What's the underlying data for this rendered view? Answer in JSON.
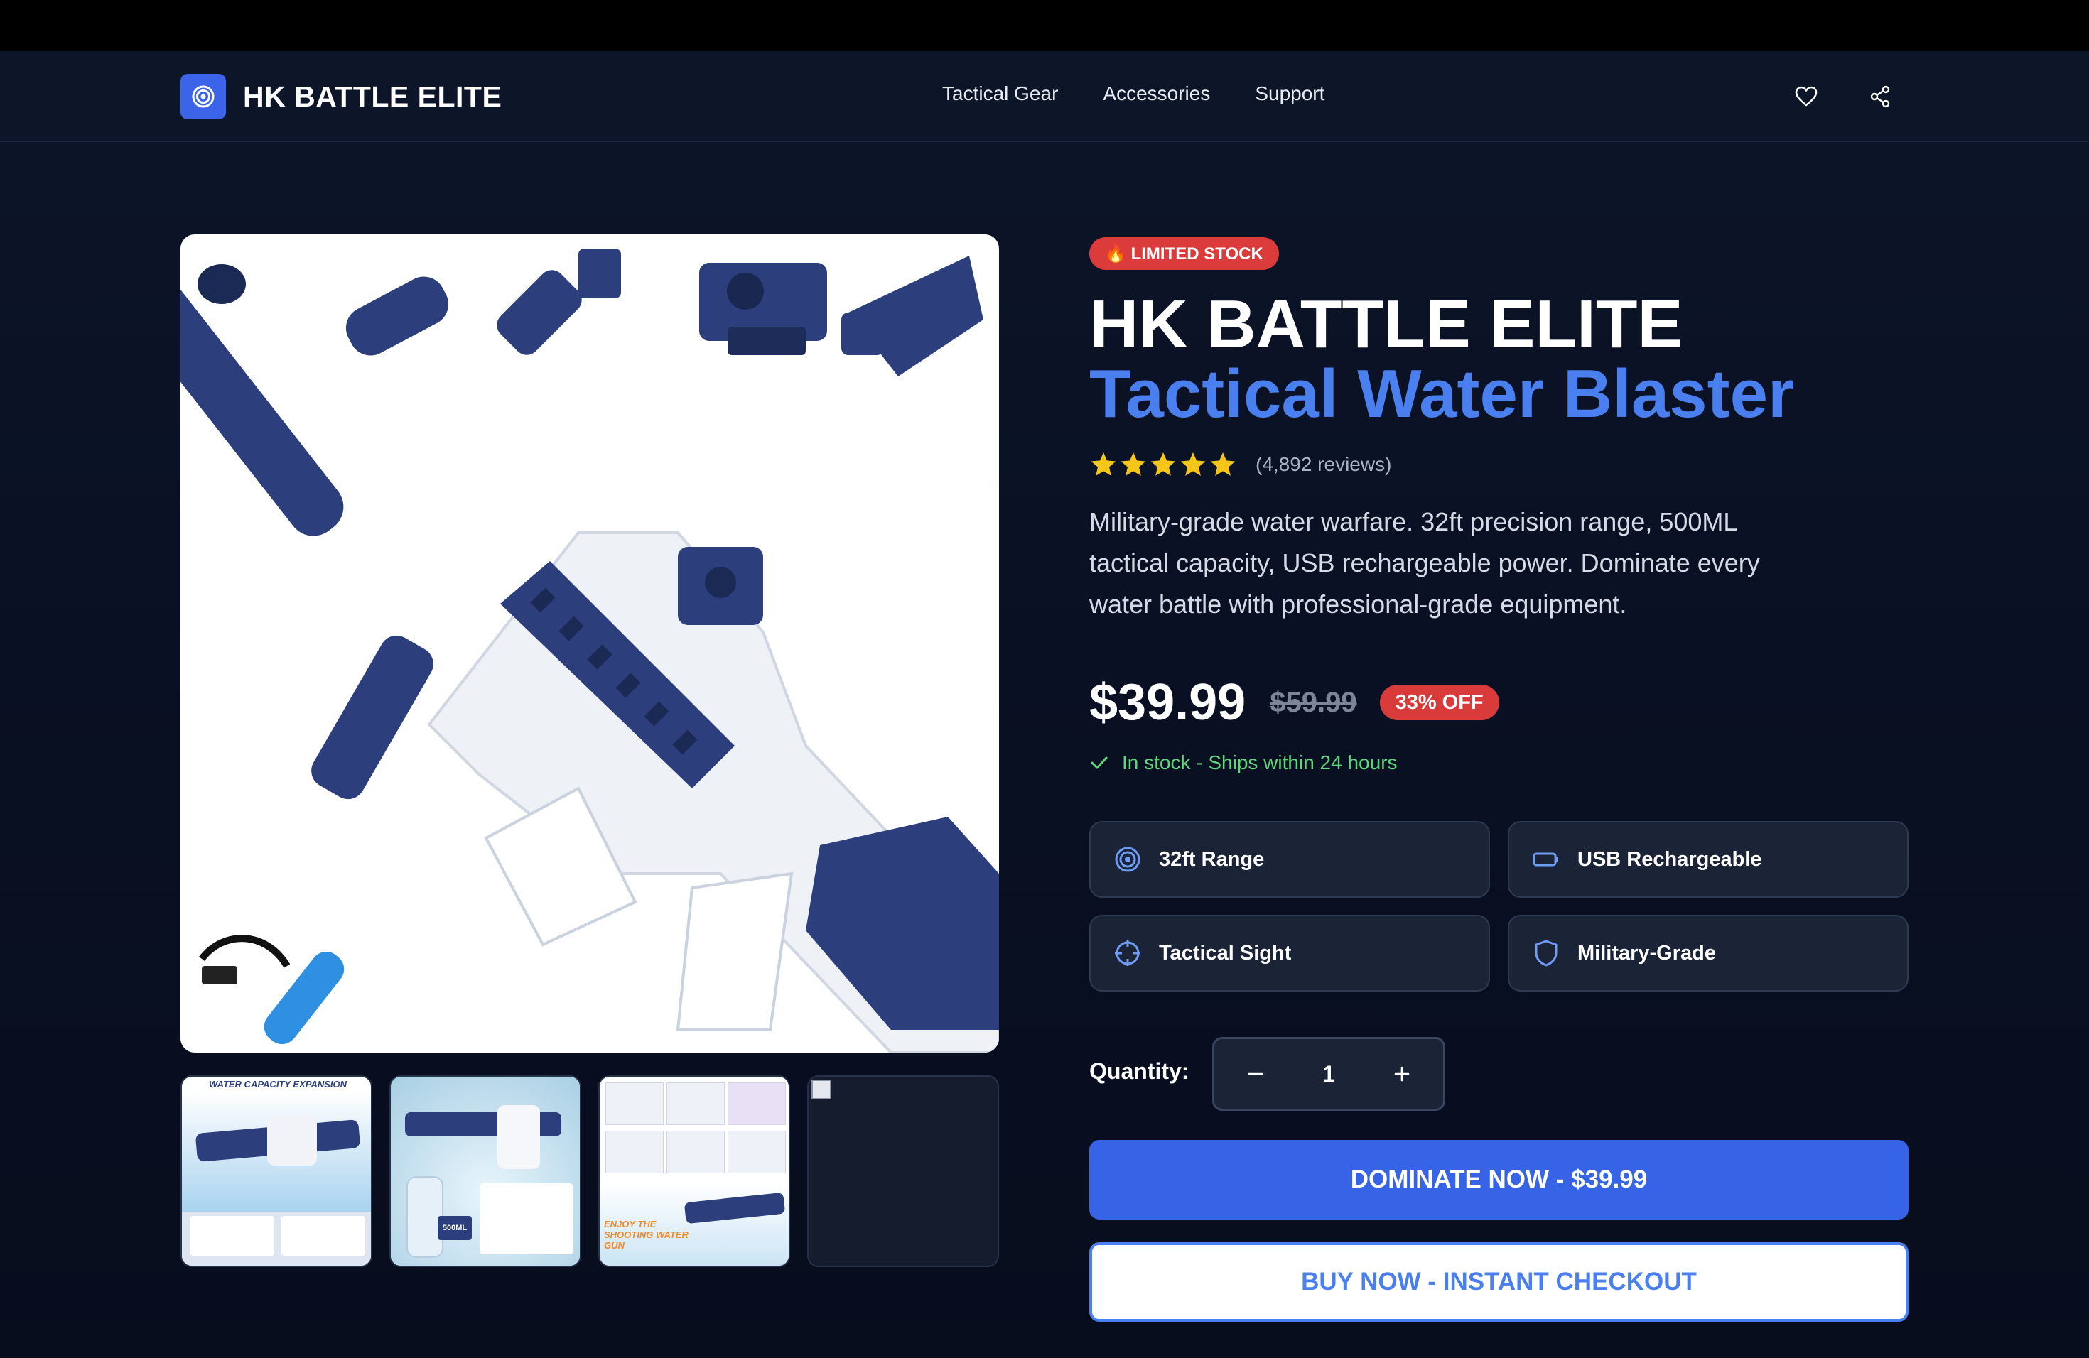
{
  "nav": {
    "brand_name": "HK BATTLE ELITE",
    "links": [
      "Tactical Gear",
      "Accessories",
      "Support"
    ],
    "icons": [
      "target-icon",
      "heart-icon",
      "share-icon"
    ]
  },
  "product": {
    "badge": "🔥 LIMITED STOCK",
    "title_line1": "HK BATTLE ELITE",
    "title_line2": "Tactical Water Blaster",
    "rating": 5,
    "reviews": "(4,892 reviews)",
    "description": "Military-grade water warfare. 32ft precision range, 500ML tactical capacity, USB rechargeable power. Dominate every water battle with professional-grade equipment.",
    "price": "$39.99",
    "old_price": "$59.99",
    "discount": "33% OFF",
    "stock_status": "In stock - Ships within 24 hours",
    "features": [
      {
        "label": "32ft Range",
        "icon": "target-icon"
      },
      {
        "label": "USB Rechargeable",
        "icon": "battery-icon"
      },
      {
        "label": "Tactical Sight",
        "icon": "crosshair-icon"
      },
      {
        "label": "Military-Grade",
        "icon": "shield-icon"
      }
    ],
    "quantity_label": "Quantity:",
    "quantity": "1",
    "primary_cta": "DOMINATE NOW - $39.99",
    "secondary_cta": "BUY NOW - INSTANT CHECKOUT"
  },
  "gallery": {
    "thumbnails": [
      {
        "caption": "WATER CAPACITY EXPANSION"
      },
      {
        "caption": "500ML"
      },
      {
        "caption": "ENJOY THE SHOOTING WATER GUN"
      },
      {
        "caption": ""
      }
    ]
  },
  "colors": {
    "accent": "#3763e6",
    "accent_text": "#4a7ff0",
    "badge_red": "#dc3b3b",
    "stock_green": "#5fd67a",
    "star_yellow": "#f5c518",
    "product_navy": "#2a3f80"
  }
}
